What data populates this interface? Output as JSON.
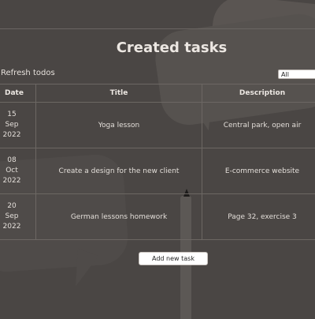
{
  "page": {
    "title": "Created tasks"
  },
  "toolbar": {
    "refresh_label": "Refresh todos",
    "filter_value": "All"
  },
  "table": {
    "headers": {
      "date": "Date",
      "title": "Title",
      "description": "Description"
    },
    "rows": [
      {
        "day": "15",
        "month": "Sep",
        "year": "2022",
        "title": "Yoga lesson",
        "description": "Central park, open air"
      },
      {
        "day": "08",
        "month": "Oct",
        "year": "2022",
        "title": "Create a design for the new client",
        "description": "E-commerce website"
      },
      {
        "day": "20",
        "month": "Sep",
        "year": "2022",
        "title": "German lessons homework",
        "description": "Page 32, exercise 3"
      }
    ]
  },
  "actions": {
    "add_task_label": "Add new task"
  },
  "colors": {
    "background": "#4a4644",
    "text": "#e6e1dc",
    "grid": "#6c6763",
    "button": "#ffffff"
  }
}
